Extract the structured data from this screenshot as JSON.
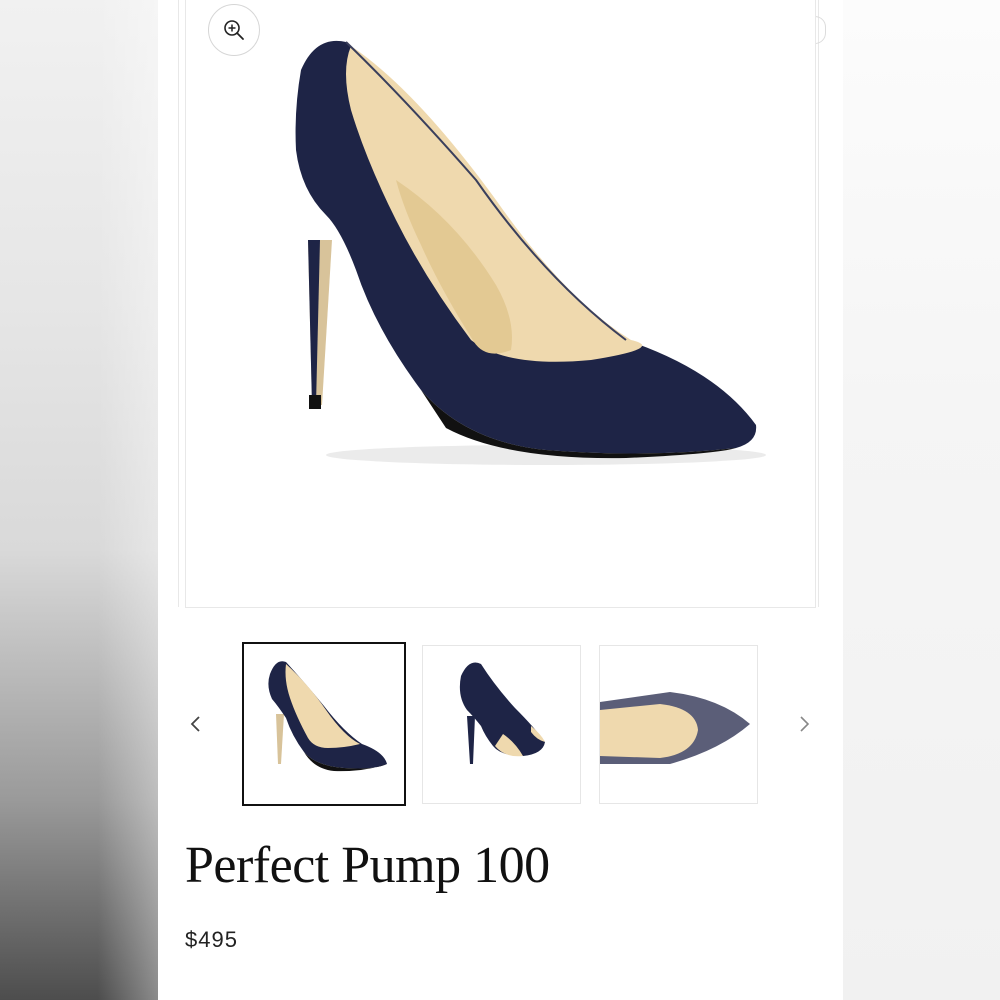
{
  "product": {
    "title": "Perfect Pump 100",
    "price": "$495"
  },
  "gallery": {
    "zoom_icon": "zoom-in-icon",
    "prev_icon": "chevron-left-icon",
    "next_icon": "chevron-right-icon",
    "thumbnails": [
      {
        "view": "side-view",
        "selected": true
      },
      {
        "view": "back-view",
        "selected": false
      },
      {
        "view": "top-view",
        "selected": false
      }
    ]
  },
  "colors": {
    "suede": "#1e2446",
    "lining": "#efd9ae",
    "text": "#111111"
  }
}
